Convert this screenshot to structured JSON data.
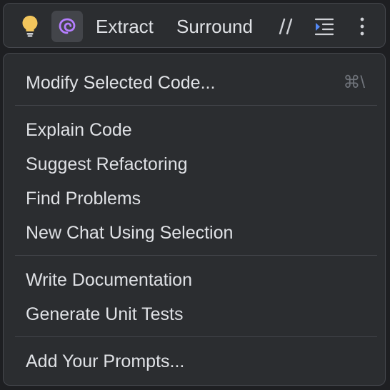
{
  "toolbar": {
    "bulb_icon": "lightbulb-icon",
    "ai_icon": "ai-assistant-spiral-icon",
    "extract_label": "Extract",
    "surround_label": "Surround",
    "comment_icon": "comment-slashes-icon",
    "indent_icon": "reformat-indent-icon",
    "more_icon": "more-vertical-icon"
  },
  "menu": {
    "groups": [
      {
        "items": [
          {
            "label": "Modify Selected Code...",
            "shortcut": "⌘\\"
          }
        ]
      },
      {
        "items": [
          {
            "label": "Explain Code"
          },
          {
            "label": "Suggest Refactoring"
          },
          {
            "label": "Find Problems"
          },
          {
            "label": "New Chat Using Selection"
          }
        ]
      },
      {
        "items": [
          {
            "label": "Write Documentation"
          },
          {
            "label": "Generate Unit Tests"
          }
        ]
      },
      {
        "items": [
          {
            "label": "Add Your Prompts..."
          }
        ]
      }
    ]
  },
  "colors": {
    "background": "#2b2d30",
    "border": "#45474d",
    "text": "#dfe1e5",
    "shortcut": "#6f737a",
    "bulb": "#f2c55c",
    "ai_accent": "#b57eff",
    "indent_accent": "#548af7"
  }
}
